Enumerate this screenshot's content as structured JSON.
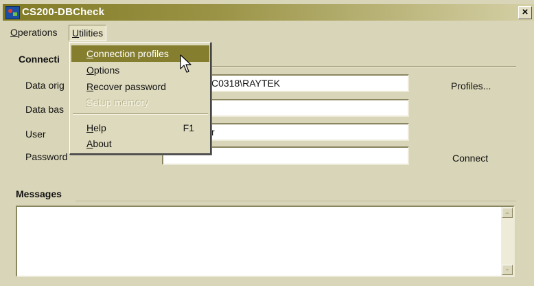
{
  "window": {
    "title": "CS200-DBCheck",
    "close_glyph": "×"
  },
  "menubar": {
    "operations": {
      "mnemonic": "O",
      "rest": "perations"
    },
    "utilities": {
      "mnemonic": "U",
      "rest": "tilities"
    }
  },
  "connection": {
    "group_title": "Connecti",
    "fields": [
      {
        "label": "Data orig",
        "value": "C0318\\RAYTEK"
      },
      {
        "label": "Data bas",
        "value": ""
      },
      {
        "label": "User",
        "value": "r"
      },
      {
        "label": "Password",
        "value": ""
      }
    ],
    "profiles_button": "Profiles...",
    "connect_button": "Connect"
  },
  "messages": {
    "group_title": "Messages",
    "content": ""
  },
  "utilities_menu": {
    "items": [
      {
        "mnemonic": "C",
        "rest": "onnection profiles",
        "state": "highlighted"
      },
      {
        "mnemonic": "O",
        "rest": "ptions",
        "state": "normal"
      },
      {
        "mnemonic": "R",
        "rest": "ecover password",
        "state": "normal"
      },
      {
        "mnemonic": "S",
        "rest": "etup memory",
        "state": "disabled"
      },
      {
        "mnemonic": "H",
        "rest": "elp",
        "shortcut": "F1",
        "state": "normal"
      },
      {
        "mnemonic": "A",
        "rest": "bout",
        "state": "normal"
      }
    ]
  },
  "colors": {
    "titlebar_start": "#817a25",
    "titlebar_end": "#d5d0a6",
    "window_bg": "#d9d5b8",
    "menu_highlight": "#857e2f"
  },
  "icons": {
    "app": "database-check-icon",
    "cursor": "mouse-pointer-icon",
    "close": "close-icon"
  }
}
